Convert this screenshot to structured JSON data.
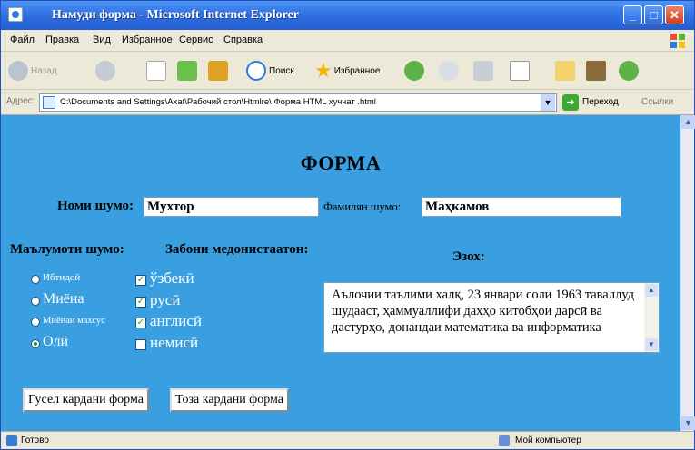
{
  "window": {
    "title": "Намуди форма - Microsoft Internet Explorer",
    "min_symbol": "_",
    "max_symbol": "□",
    "close_symbol": "✕"
  },
  "menu": [
    "Файл",
    "Правка",
    "Вид",
    "Избранное",
    "Сервис",
    "Справка"
  ],
  "toolbar": {
    "back": "Назад",
    "search": "Поиск",
    "favorites": "Избранное"
  },
  "address": {
    "label": "Адрес:",
    "value": "C:\\Documents and Settings\\Axat\\Рабочий стол\\Htmlre\\ Форма HTML хуччат .html",
    "go": "Переход",
    "links": "Ссылки"
  },
  "status": {
    "text": "Готово",
    "zone": "Мой компьютер"
  },
  "form": {
    "heading": "ФОРМА",
    "first_name_label": "Номи шумо:",
    "first_name_value": "Мухтор",
    "last_name_label": "Фамилян шумо:",
    "last_name_value": "Маҳкамов",
    "education_label": "Маълумоти шумо:",
    "languages_label": "Забони медонистаатон:",
    "note_label": "Эзох:",
    "education_options": [
      {
        "label": "Ибтидоӣ",
        "selected": false
      },
      {
        "label": "Миёна",
        "selected": false
      },
      {
        "label": "Миёнаи махсус",
        "selected": false
      },
      {
        "label": "Олӣ",
        "selected": true
      }
    ],
    "language_options": [
      {
        "label": "ўзбекӣ",
        "checked": true
      },
      {
        "label": "русӣ",
        "checked": true
      },
      {
        "label": "англисӣ",
        "checked": true
      },
      {
        "label": "немисӣ",
        "checked": false
      }
    ],
    "note_text": "Аълочии таълими халқ, 23 январи соли 1963 таваллуд шудааст, ҳаммуаллифи даҳҳо китобҳои дарсӣ ва дастурҳо, донандаи математика ва информатика",
    "submit_button": "Гусел кардани форма",
    "reset_button": "Тоза кардани форма"
  },
  "colors": {
    "page_background": "#3a9fe0",
    "title_bar": "#2f6fe0",
    "chrome": "#ece9d8"
  }
}
